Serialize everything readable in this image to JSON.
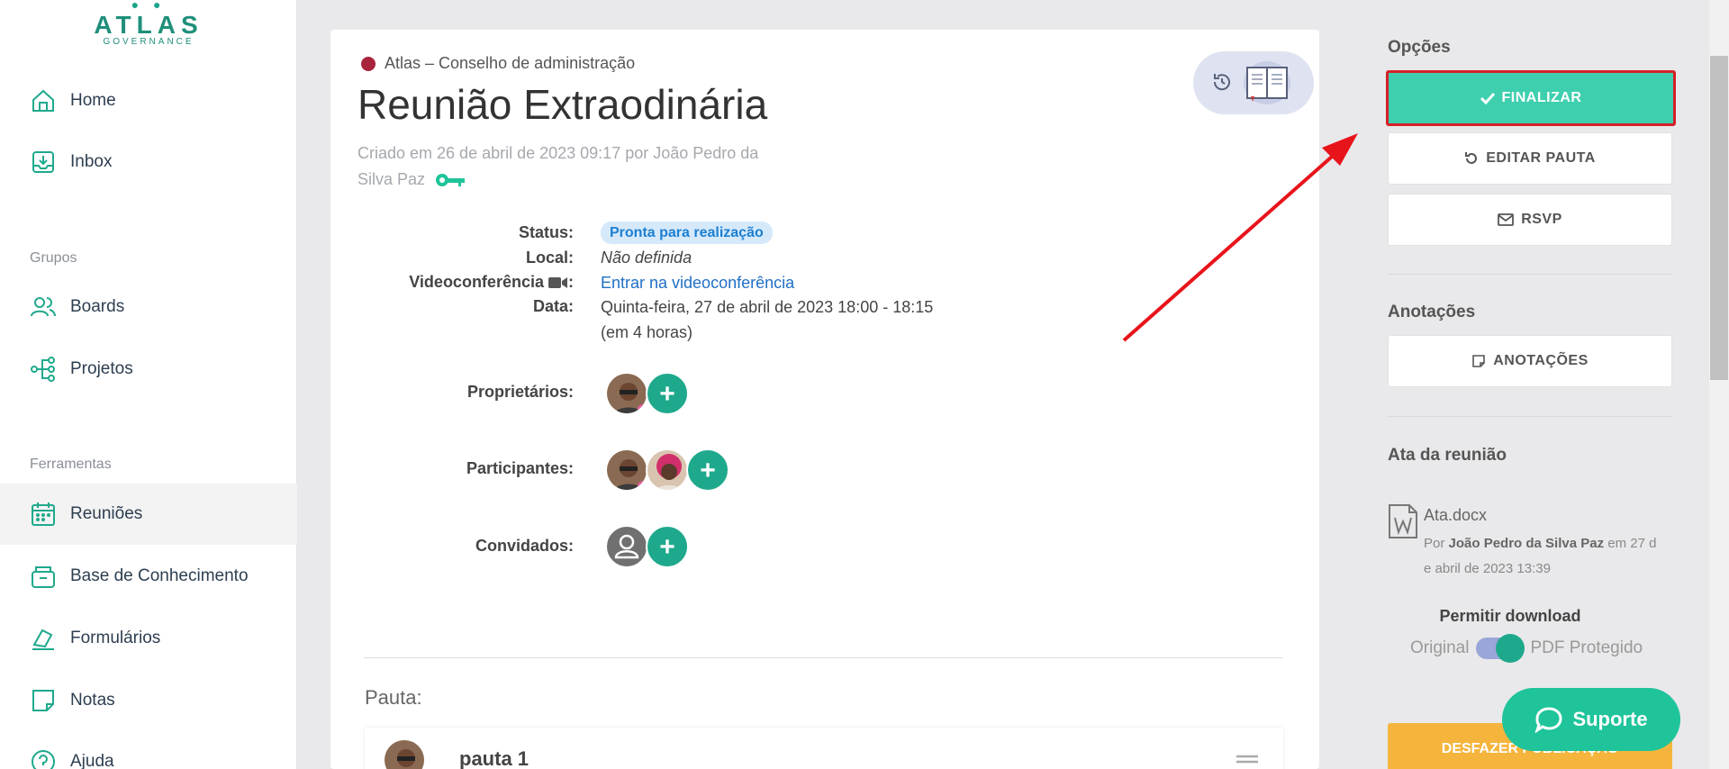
{
  "brand": {
    "name": "ATLAS",
    "sub": "GOVERNANCE"
  },
  "sidebar": {
    "items": [
      {
        "label": "Home",
        "icon": "home-icon"
      },
      {
        "label": "Inbox",
        "icon": "inbox-icon"
      },
      {
        "label": "Boards",
        "icon": "users-icon"
      },
      {
        "label": "Projetos",
        "icon": "network-icon"
      },
      {
        "label": "Reuniões",
        "icon": "calendar-icon"
      },
      {
        "label": "Base de Conhecimento",
        "icon": "archive-icon"
      },
      {
        "label": "Formulários",
        "icon": "form-icon"
      },
      {
        "label": "Notas",
        "icon": "note-icon"
      },
      {
        "label": "Ajuda",
        "icon": "help-icon"
      }
    ],
    "section_groups": "Grupos",
    "section_tools": "Ferramentas"
  },
  "meeting": {
    "org": "Atlas – Conselho de administração",
    "title": "Reunião Extraodinária",
    "created_line1": "Criado em 26 de abril de 2023 09:17 por João Pedro da",
    "created_line2": "Silva Paz",
    "labels": {
      "status": "Status:",
      "local": "Local:",
      "video": "Videoconferência",
      "date": "Data:",
      "owners": "Proprietários:",
      "participants": "Participantes:",
      "guests": "Convidados:"
    },
    "status": "Pronta para realização",
    "local": "Não definida",
    "video_link": "Entrar na videoconferência",
    "date": "Quinta-feira, 27 de abril de 2023 18:00 - 18:15",
    "date_relative": "(em 4 horas)",
    "pauta_label": "Pauta:",
    "pauta_item": "pauta 1"
  },
  "panel": {
    "options_title": "Opções",
    "finalize": "FINALIZAR",
    "edit_agenda": "EDITAR PAUTA",
    "rsvp": "RSVP",
    "notes_title": "Anotações",
    "notes_btn": "ANOTAÇÕES",
    "minutes_title": "Ata da reunião",
    "file_name": "Ata.docx",
    "file_by": "Por",
    "file_author": "João Pedro da Silva Paz",
    "file_date_a": "em 27 d",
    "file_date_b": "e abril de 2023 13:39",
    "allow_download": "Permitir download",
    "toggle_left": "Original",
    "toggle_right": "PDF Protegido",
    "undo": "DESFAZER PUBLICAÇÃO",
    "support": "Suporte"
  },
  "colors": {
    "accent": "#1fa98c",
    "finalize": "#3ecfae",
    "highlight": "#d6202a",
    "org_dot": "#a8243c"
  }
}
